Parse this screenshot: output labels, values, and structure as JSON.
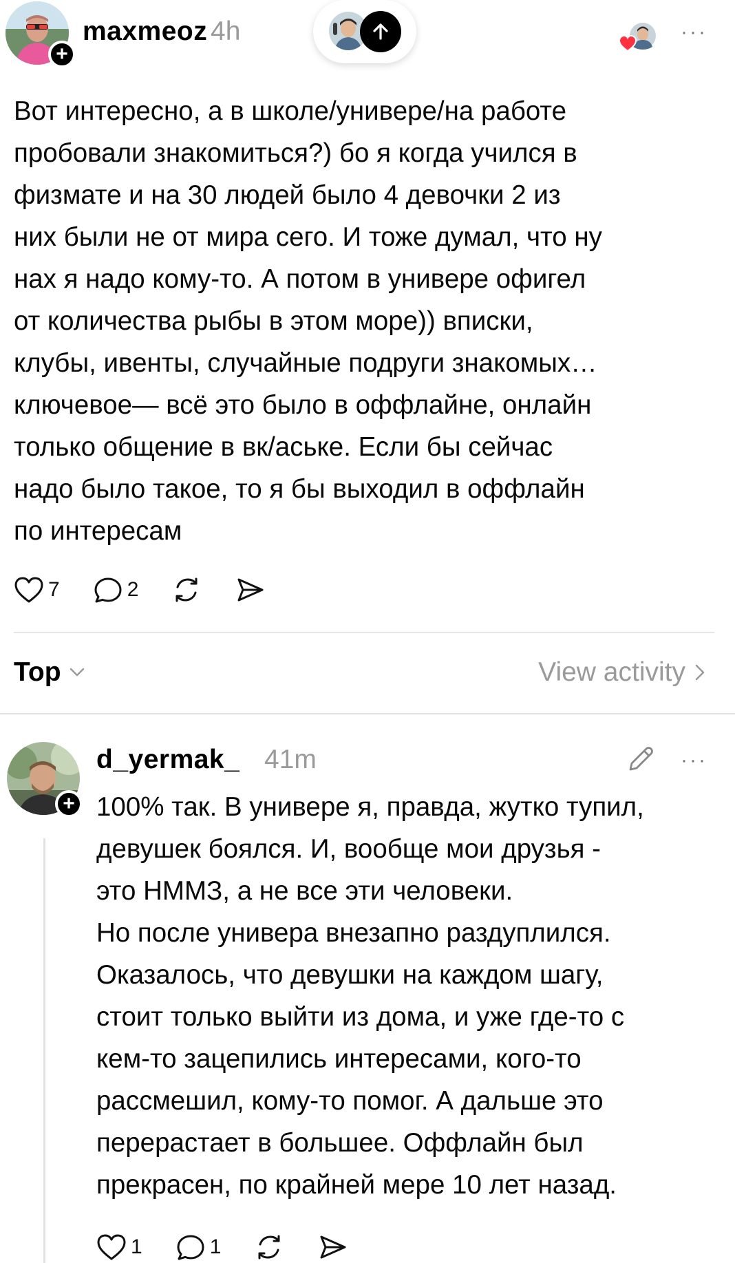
{
  "post": {
    "username": "maxmeoz",
    "time": "4h",
    "text_lines": [
      "Вот интересно, а в школе/универе/на работе",
      "пробовали знакомиться?) бо я когда учился в",
      "физмате и на 30 людей было 4 девочки 2 из",
      "них были не от мира сего. И тоже думал, что ну",
      "нах я надо кому-то. А потом в универе офигел",
      "от количества рыбы в этом море)) вписки,",
      "клубы, ивенты, случайные подруги знакомых…",
      "ключевое— всё это было в оффлайне, онлайн",
      "только общение в вк/аське. Если бы сейчас",
      "надо было такое, то я бы выходил в оффлайн",
      "по интересам"
    ],
    "likes": "7",
    "replies": "2",
    "follow_symbol": "+"
  },
  "replies_header": {
    "sort_label": "Top",
    "activity_label": "View activity"
  },
  "reply": {
    "username": "d_yermak_",
    "time": "41m",
    "text_lines": [
      "100% так. В универе я, правда, жутко тупил,",
      "девушек боялся. И, вообще мои друзья -",
      "это НММЗ, а не все эти человеки.",
      "Но после универа внезапно раздуплился.",
      "Оказалось, что девушки на каждом шагу,",
      "стоит только выйти из дома, и уже где-то с",
      "кем-то зацепились интересами, кого-то",
      "рассмешил, кому-то помог. А дальше это",
      "перерастает в большее. Оффлайн был",
      "прекрасен, по крайней мере 10 лет назад."
    ],
    "likes": "1",
    "replies": "1",
    "follow_symbol": "+"
  },
  "icons": {
    "more": "more-dots-icon",
    "like": "heart-icon",
    "reply": "comment-icon",
    "repost": "repost-icon",
    "share": "send-icon",
    "edit": "pencil-icon",
    "scroll_top": "arrow-up-icon"
  },
  "more_symbol": "···",
  "colors": {
    "text": "#0a0a0a",
    "muted": "#9a9a9a",
    "like_red": "#ff3040",
    "divider": "#e2e2e2"
  }
}
